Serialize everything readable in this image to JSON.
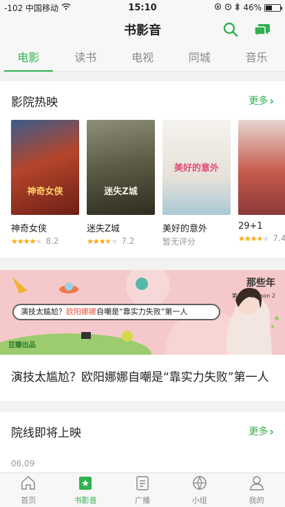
{
  "status": {
    "carrier": "-102 中国移动",
    "time": "15:10",
    "battery": "46%",
    "battery_level": 0.46
  },
  "nav": {
    "title": "书影音",
    "search_icon": "search-icon",
    "chat_icon": "chat-icon"
  },
  "tabs": [
    {
      "label": "电影",
      "active": true
    },
    {
      "label": "读书"
    },
    {
      "label": "电视"
    },
    {
      "label": "同城"
    },
    {
      "label": "音乐"
    }
  ],
  "in_theaters": {
    "title": "影院热映",
    "more": "更多",
    "movies": [
      {
        "title": "神奇女侠",
        "rating": 8.2,
        "stars": 4.1,
        "score": "8.2",
        "poster_text": "神奇女侠",
        "poster_color": "#7a2a1c"
      },
      {
        "title": "迷失Z城",
        "rating": 7.2,
        "stars": 3.6,
        "score": "7.2",
        "poster_text": "迷失Z城",
        "poster_color": "#4a4a38"
      },
      {
        "title": "美好的意外",
        "rating": null,
        "stars": 0,
        "no_score": "暂无评分",
        "poster_text": "美好的意外",
        "poster_color": "#e8e6e0"
      },
      {
        "title": "29+1",
        "rating": 7.4,
        "stars": 3.7,
        "score": "7.4",
        "poster_text": "",
        "poster_color": "#c85a4a"
      }
    ]
  },
  "banner": {
    "bubble_prefix": "演技太尴尬？",
    "bubble_highlight": "欧阳娜娜",
    "bubble_suffix": "自嘲是“靠实力失败”第一人",
    "logo_text": "豆瓣出品",
    "badge_text": "那些年",
    "badge_sub": "第二季 Season 2",
    "headline": "演技太尴尬？欧阳娜娜自嘲是“靠实力失败”第一人"
  },
  "coming_soon": {
    "title": "院线即将上映",
    "more": "更多",
    "date": "06.09"
  },
  "bottom_nav": [
    {
      "label": "首页",
      "icon": "home-icon"
    },
    {
      "label": "书影音",
      "icon": "bookmark-icon",
      "active": true
    },
    {
      "label": "广播",
      "icon": "broadcast-icon"
    },
    {
      "label": "小组",
      "icon": "group-icon"
    },
    {
      "label": "我的",
      "icon": "profile-icon"
    }
  ],
  "colors": {
    "accent": "#2fb14f",
    "star": "#ffa800"
  }
}
